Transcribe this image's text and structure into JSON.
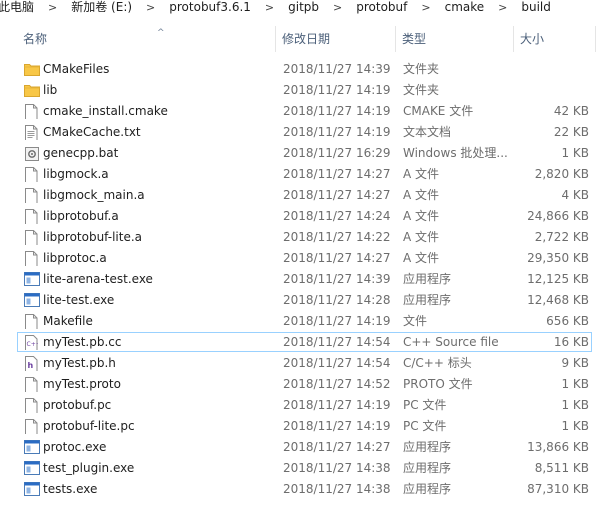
{
  "breadcrumb": [
    "此电脑",
    "新加卷 (E:)",
    "protobuf3.6.1",
    "gitpb",
    "protobuf",
    "cmake",
    "build"
  ],
  "columns": {
    "name": "名称",
    "date": "修改日期",
    "type": "类型",
    "size": "大小"
  },
  "colors": {
    "folder": "#f8c747",
    "selection_border": "#99d1ff",
    "header_text": "#4c607a",
    "secondary_text": "#6d6d6d"
  },
  "files": [
    {
      "name": "CMakeFiles",
      "date": "2018/11/27 14:39",
      "type": "文件夹",
      "size": "",
      "icon": "folder-icon"
    },
    {
      "name": "lib",
      "date": "2018/11/27 14:19",
      "type": "文件夹",
      "size": "",
      "icon": "folder-icon"
    },
    {
      "name": "cmake_install.cmake",
      "date": "2018/11/27 14:19",
      "type": "CMAKE 文件",
      "size": "42 KB",
      "icon": "file-icon"
    },
    {
      "name": "CMakeCache.txt",
      "date": "2018/11/27 14:19",
      "type": "文本文档",
      "size": "22 KB",
      "icon": "text-file-icon"
    },
    {
      "name": "genecpp.bat",
      "date": "2018/11/27 16:29",
      "type": "Windows 批处理...",
      "size": "1 KB",
      "icon": "batch-file-icon"
    },
    {
      "name": "libgmock.a",
      "date": "2018/11/27 14:27",
      "type": "A 文件",
      "size": "2,820 KB",
      "icon": "file-icon"
    },
    {
      "name": "libgmock_main.a",
      "date": "2018/11/27 14:27",
      "type": "A 文件",
      "size": "4 KB",
      "icon": "file-icon"
    },
    {
      "name": "libprotobuf.a",
      "date": "2018/11/27 14:24",
      "type": "A 文件",
      "size": "24,866 KB",
      "icon": "file-icon"
    },
    {
      "name": "libprotobuf-lite.a",
      "date": "2018/11/27 14:22",
      "type": "A 文件",
      "size": "2,722 KB",
      "icon": "file-icon"
    },
    {
      "name": "libprotoc.a",
      "date": "2018/11/27 14:27",
      "type": "A 文件",
      "size": "29,350 KB",
      "icon": "file-icon"
    },
    {
      "name": "lite-arena-test.exe",
      "date": "2018/11/27 14:39",
      "type": "应用程序",
      "size": "12,125 KB",
      "icon": "exe-icon"
    },
    {
      "name": "lite-test.exe",
      "date": "2018/11/27 14:28",
      "type": "应用程序",
      "size": "12,468 KB",
      "icon": "exe-icon"
    },
    {
      "name": "Makefile",
      "date": "2018/11/27 14:19",
      "type": "文件",
      "size": "656 KB",
      "icon": "file-icon"
    },
    {
      "name": "myTest.pb.cc",
      "date": "2018/11/27 14:54",
      "type": "C++ Source file",
      "size": "16 KB",
      "icon": "cpp-file-icon",
      "selected": true
    },
    {
      "name": "myTest.pb.h",
      "date": "2018/11/27 14:54",
      "type": "C/C++ 标头",
      "size": "9 KB",
      "icon": "header-file-icon"
    },
    {
      "name": "myTest.proto",
      "date": "2018/11/27 14:52",
      "type": "PROTO 文件",
      "size": "1 KB",
      "icon": "file-icon"
    },
    {
      "name": "protobuf.pc",
      "date": "2018/11/27 14:19",
      "type": "PC 文件",
      "size": "1 KB",
      "icon": "file-icon"
    },
    {
      "name": "protobuf-lite.pc",
      "date": "2018/11/27 14:19",
      "type": "PC 文件",
      "size": "1 KB",
      "icon": "file-icon"
    },
    {
      "name": "protoc.exe",
      "date": "2018/11/27 14:27",
      "type": "应用程序",
      "size": "13,866 KB",
      "icon": "exe-icon"
    },
    {
      "name": "test_plugin.exe",
      "date": "2018/11/27 14:38",
      "type": "应用程序",
      "size": "8,511 KB",
      "icon": "exe-icon"
    },
    {
      "name": "tests.exe",
      "date": "2018/11/27 14:38",
      "type": "应用程序",
      "size": "87,310 KB",
      "icon": "exe-icon"
    }
  ]
}
